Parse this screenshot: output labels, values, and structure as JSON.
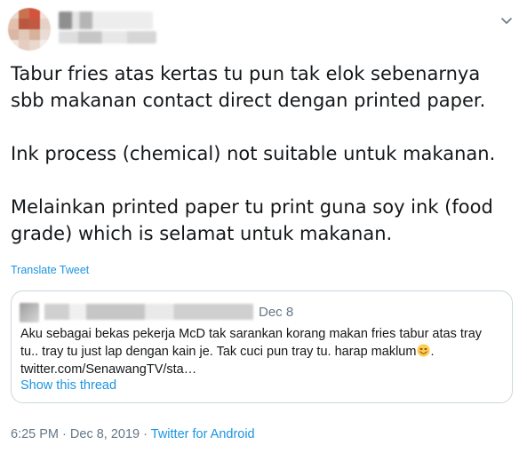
{
  "tweet": {
    "paragraphs": [
      "Tabur fries atas kertas tu pun tak elok sebenarnya sbb makanan contact direct dengan printed paper.",
      "Ink process (chemical) not suitable untuk makanan.",
      "Melainkan printed paper tu print guna soy ink (food grade) which is selamat untuk makanan."
    ],
    "translate_label": "Translate Tweet",
    "time": "6:25 PM",
    "date": "Dec 8, 2019",
    "separator": "·",
    "client": "Twitter for Android"
  },
  "quote": {
    "date": "Dec 8",
    "text_line1": "Aku sebagai bekas pekerja McD tak sarankan korang makan fries tabur atas tray",
    "text_line2": "tu.. tray tu just lap dengan kain je. Tak cuci pun tray tu. harap maklum",
    "text_line2_end": ".",
    "link_text": "twitter.com/SenawangTV/sta…",
    "show_thread_label": "Show this thread"
  },
  "colors": {
    "link": "#1b95e0",
    "muted": "#657786",
    "border": "#ccd6dd",
    "text": "#14171a"
  }
}
